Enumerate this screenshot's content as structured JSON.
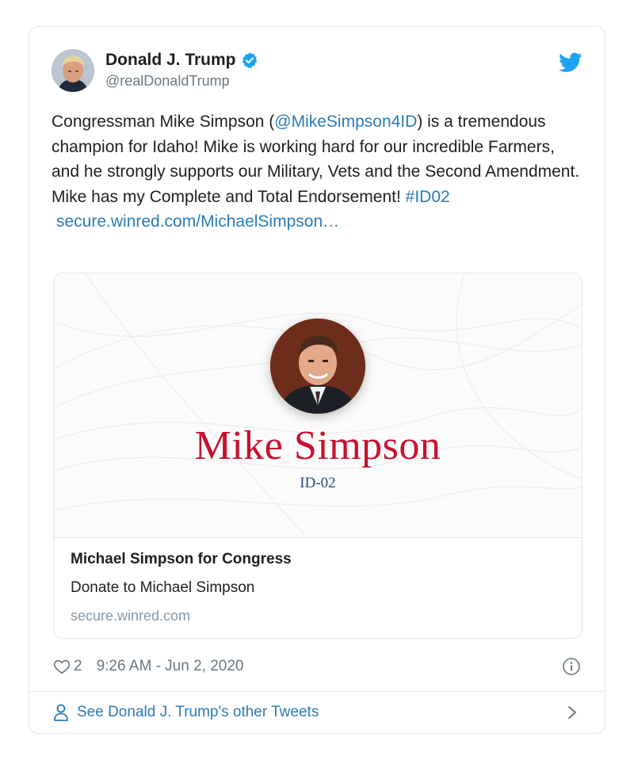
{
  "author": {
    "display_name": "Donald J. Trump",
    "handle": "@realDonaldTrump",
    "verified": true
  },
  "tweet": {
    "text_part1": "Congressman Mike Simpson (",
    "mention": "@MikeSimpson4ID",
    "text_part2": ") is a tremendous champion for Idaho! Mike is working hard for our incredible Farmers, and he strongly supports our Military, Vets and the Second Amendment. Mike has my Complete and Total Endorsement! ",
    "hashtag": "#ID02",
    "url": "secure.winred.com/MichaelSimpson…"
  },
  "card": {
    "banner_name": "Mike Simpson",
    "banner_district": "ID-02",
    "title": "Michael Simpson for Congress",
    "description": "Donate to Michael Simpson",
    "domain": "secure.winred.com"
  },
  "footer": {
    "like_count": "2",
    "timestamp": "9:26 AM - Jun 2, 2020",
    "see_more_label": "See Donald J. Trump's other Tweets"
  },
  "colors": {
    "link": "#2b7bb9",
    "verified": "#1da1f2",
    "banner_name": "#c8102e",
    "muted": "#697882"
  },
  "icons": [
    "verified-badge-icon",
    "twitter-bird-icon",
    "heart-icon",
    "info-icon",
    "person-icon",
    "chevron-right-icon"
  ]
}
